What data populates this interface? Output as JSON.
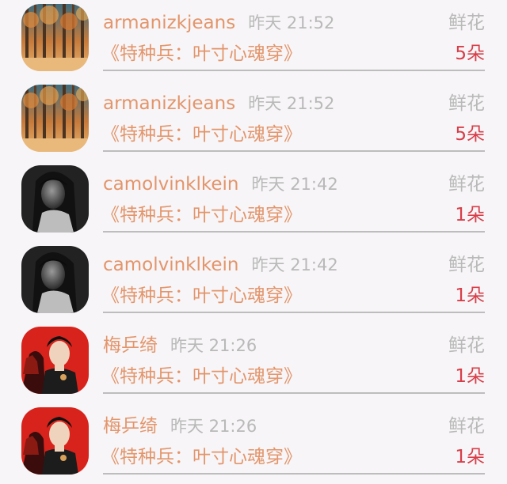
{
  "items": [
    {
      "name": "armanizkjeans",
      "time": "昨天 21:52",
      "gift_label": "鲜花",
      "title": "《特种兵：叶寸心魂穿》",
      "count": "5朵",
      "avatar": "autumn-forest-avatar"
    },
    {
      "name": "armanizkjeans",
      "time": "昨天 21:52",
      "gift_label": "鲜花",
      "title": "《特种兵：叶寸心魂穿》",
      "count": "5朵",
      "avatar": "autumn-forest-avatar"
    },
    {
      "name": "camolvinklkein",
      "time": "昨天 21:42",
      "gift_label": "鲜花",
      "title": "《特种兵：叶寸心魂穿》",
      "count": "1朵",
      "avatar": "monochrome-portrait-avatar"
    },
    {
      "name": "camolvinklkein",
      "time": "昨天 21:42",
      "gift_label": "鲜花",
      "title": "《特种兵：叶寸心魂穿》",
      "count": "1朵",
      "avatar": "monochrome-portrait-avatar"
    },
    {
      "name": "梅乒绮",
      "time": "昨天 21:26",
      "gift_label": "鲜花",
      "title": "《特种兵：叶寸心魂穿》",
      "count": "1朵",
      "avatar": "red-fan-portrait-avatar"
    },
    {
      "name": "梅乒绮",
      "time": "昨天 21:26",
      "gift_label": "鲜花",
      "title": "《特种兵：叶寸心魂穿》",
      "count": "1朵",
      "avatar": "red-fan-portrait-avatar"
    }
  ],
  "colors": {
    "background": "#f7f5f7",
    "name_orange": "#e3956b",
    "muted_gray": "#b9b9b9",
    "count_red": "#d73e49",
    "divider": "#bdbdbd"
  }
}
